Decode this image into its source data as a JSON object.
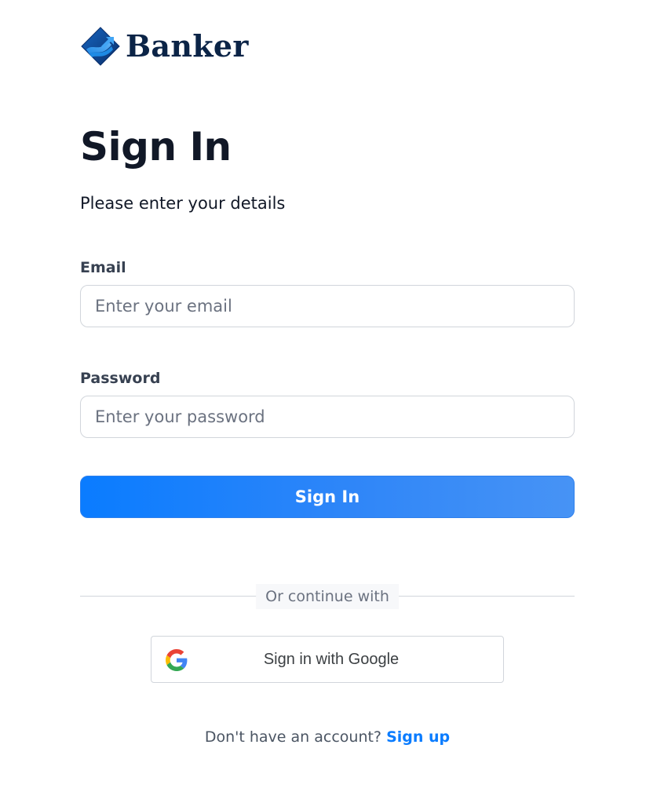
{
  "brand": {
    "name": "Banker",
    "logo_icon": "banker-logo-icon",
    "color": "#0b2447"
  },
  "form": {
    "title": "Sign In",
    "subtitle": "Please enter your details",
    "email": {
      "label": "Email",
      "placeholder": "Enter your email",
      "value": ""
    },
    "password": {
      "label": "Password",
      "placeholder": "Enter your password",
      "value": ""
    },
    "submit_label": "Sign In"
  },
  "divider": {
    "text": "Or continue with"
  },
  "google": {
    "label": "Sign in with Google",
    "icon": "google-icon"
  },
  "footer": {
    "prompt": "Don't have an account?",
    "link_label": "Sign up"
  },
  "colors": {
    "accent": "#0a7cff",
    "text_primary": "#111827",
    "border": "#d1d5db"
  }
}
